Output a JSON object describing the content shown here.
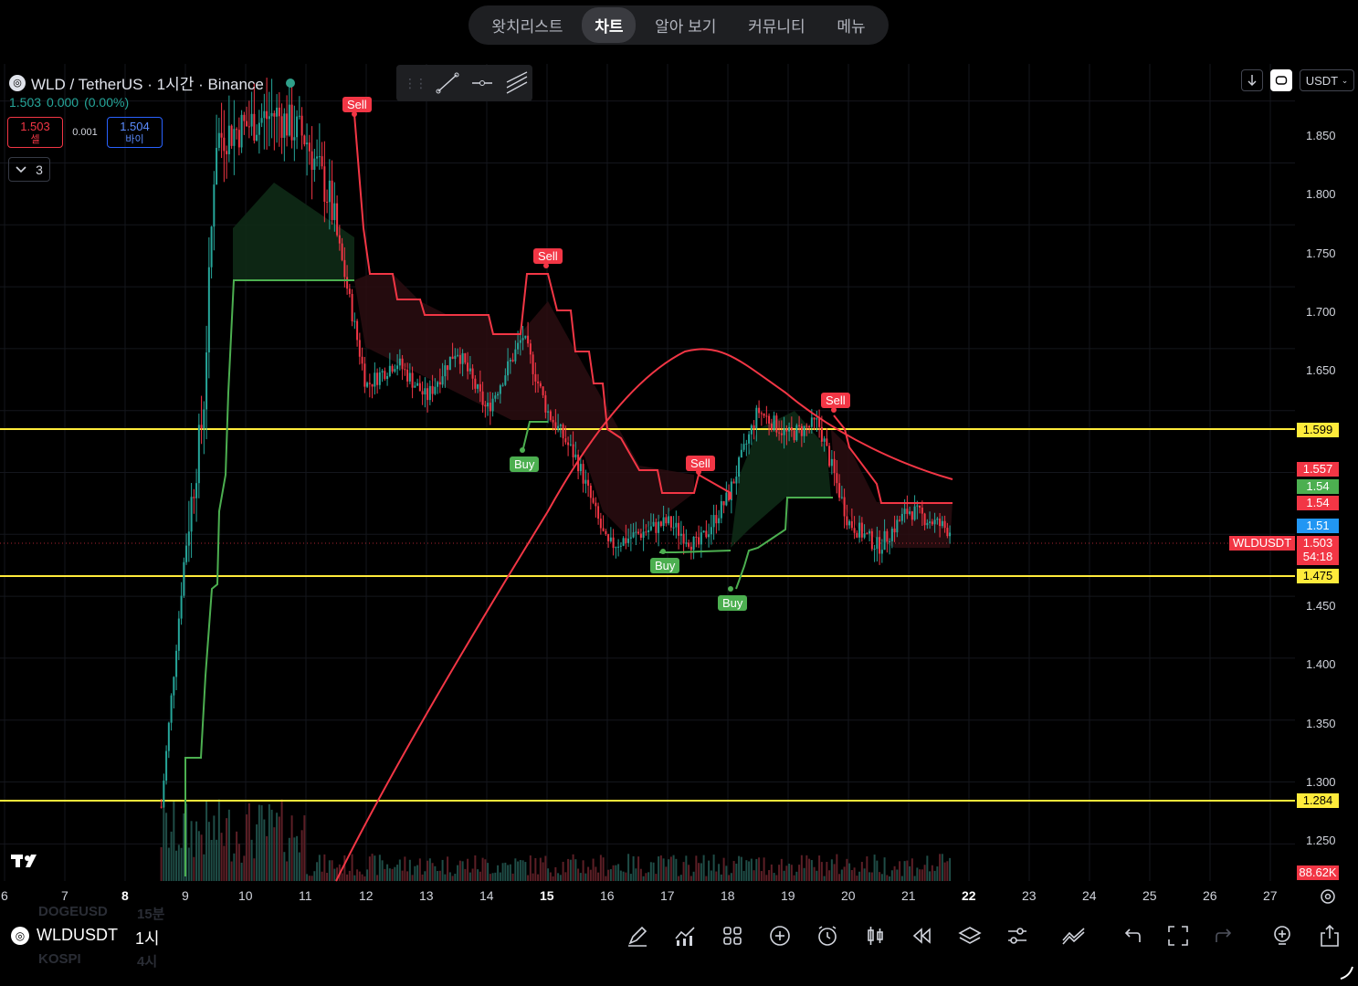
{
  "nav": {
    "tabs": [
      "왓치리스트",
      "차트",
      "알아 보기",
      "커뮤니티",
      "메뉴"
    ],
    "active": "차트"
  },
  "symbol": {
    "title": "WLD / TetherUS · 1시간 · Binance",
    "last": "1.503",
    "change": "0.000",
    "change_pct": "(0.00%)",
    "bid": "1.503",
    "bid_label": "셀",
    "ask": "1.504",
    "ask_label": "바이",
    "spread": "0.001",
    "indicators_count": "3"
  },
  "currency": "USDT",
  "price_axis": [
    "1.850",
    "1.800",
    "1.750",
    "1.700",
    "1.650",
    "1.450",
    "1.400",
    "1.350",
    "1.300",
    "1.250"
  ],
  "price_tags": {
    "line_1599": "1.599",
    "red_1557": "1.557",
    "green_154": "1.54",
    "red_154": "1.54",
    "blue_151": "1.51",
    "current": "1.503",
    "countdown": "54:18",
    "line_1475": "1.475",
    "line_1284": "1.284",
    "volume": "88.62K",
    "symbol_tag": "WLDUSDT"
  },
  "time_axis": [
    "6",
    "7",
    "8",
    "9",
    "10",
    "11",
    "12",
    "13",
    "14",
    "15",
    "16",
    "17",
    "18",
    "19",
    "20",
    "21",
    "22",
    "23",
    "24",
    "25",
    "26",
    "27"
  ],
  "time_axis_bold": [
    "8",
    "15",
    "22"
  ],
  "signals": [
    {
      "type": "Sell",
      "label": "Sell"
    },
    {
      "type": "Sell",
      "label": "Sell"
    },
    {
      "type": "Buy",
      "label": "Buy"
    },
    {
      "type": "Sell",
      "label": "Sell"
    },
    {
      "type": "Buy",
      "label": "Buy"
    },
    {
      "type": "Buy",
      "label": "Buy"
    },
    {
      "type": "Sell",
      "label": "Sell"
    }
  ],
  "colors": {
    "up": "#26a69a",
    "down": "#f23645",
    "hline": "#ffeb3b",
    "ma": "#f23645",
    "stop_green": "#4caf50"
  },
  "bottom": {
    "symbol": "WLDUSDT",
    "timeframe": "1시",
    "ghost1": "DOGEUSD",
    "ghost1b": "15분",
    "ghost2": "KOSPI",
    "ghost2b": "4시"
  },
  "chart_data": {
    "type": "candlestick",
    "title": "WLD / TetherUS · 1시간 · Binance",
    "xlabel": "",
    "ylabel": "",
    "ylim": [
      1.22,
      1.88
    ],
    "x_ticks": [
      "6",
      "7",
      "8",
      "9",
      "10",
      "11",
      "12",
      "13",
      "14",
      "15",
      "16",
      "17",
      "18",
      "19",
      "20",
      "21",
      "22",
      "23",
      "24",
      "25",
      "26",
      "27"
    ],
    "y_ticks": [
      1.25,
      1.3,
      1.35,
      1.4,
      1.45,
      1.5,
      1.55,
      1.6,
      1.65,
      1.7,
      1.75,
      1.8,
      1.85
    ],
    "horizontal_lines": [
      1.599,
      1.475,
      1.284
    ],
    "current_price": 1.503,
    "series_close_approx": [
      {
        "x": "8.6",
        "y": 1.28
      },
      {
        "x": "9",
        "y": 1.49
      },
      {
        "x": "9.3",
        "y": 1.6
      },
      {
        "x": "9.5",
        "y": 1.82
      },
      {
        "x": "10",
        "y": 1.83
      },
      {
        "x": "10.5",
        "y": 1.84
      },
      {
        "x": "11",
        "y": 1.82
      },
      {
        "x": "11.4",
        "y": 1.77
      },
      {
        "x": "12",
        "y": 1.62
      },
      {
        "x": "12.5",
        "y": 1.64
      },
      {
        "x": "13",
        "y": 1.61
      },
      {
        "x": "13.5",
        "y": 1.65
      },
      {
        "x": "14",
        "y": 1.6
      },
      {
        "x": "14.6",
        "y": 1.66
      },
      {
        "x": "15",
        "y": 1.6
      },
      {
        "x": "15.5",
        "y": 1.56
      },
      {
        "x": "16",
        "y": 1.49
      },
      {
        "x": "16.5",
        "y": 1.5
      },
      {
        "x": "17",
        "y": 1.51
      },
      {
        "x": "17.5",
        "y": 1.49
      },
      {
        "x": "18",
        "y": 1.53
      },
      {
        "x": "18.5",
        "y": 1.6
      },
      {
        "x": "19",
        "y": 1.58
      },
      {
        "x": "19.5",
        "y": 1.59
      },
      {
        "x": "20",
        "y": 1.51
      },
      {
        "x": "20.5",
        "y": 1.49
      },
      {
        "x": "21",
        "y": 1.52
      },
      {
        "x": "21.7",
        "y": 1.503
      }
    ]
  }
}
